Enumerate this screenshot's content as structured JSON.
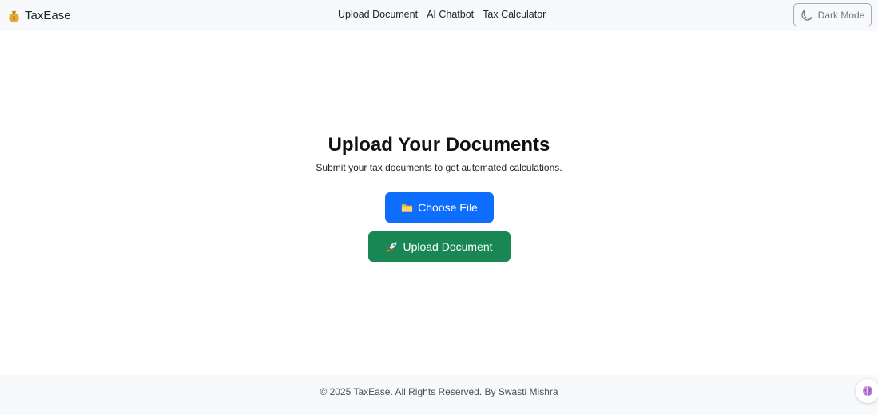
{
  "navbar": {
    "brand_name": "TaxEase",
    "brand_icon": "money-bag-icon",
    "links": [
      {
        "label": "Upload Document"
      },
      {
        "label": "AI Chatbot"
      },
      {
        "label": "Tax Calculator"
      }
    ],
    "dark_mode_label": "Dark Mode",
    "dark_mode_icon": "moon-icon"
  },
  "main": {
    "title": "Upload Your Documents",
    "subtitle": "Submit your tax documents to get automated calculations.",
    "choose_file_label": "Choose File",
    "choose_file_icon": "folder-icon",
    "upload_label": "Upload Document",
    "upload_icon": "rocket-icon"
  },
  "footer": {
    "text": "© 2025 TaxEase. All Rights Reserved. By Swasti Mishra",
    "fab_icon": "brain-icon"
  },
  "colors": {
    "navbar_bg": "#f8f9fa",
    "primary": "#0d6efd",
    "success": "#198754",
    "footer_bg": "#f8f9fa"
  }
}
